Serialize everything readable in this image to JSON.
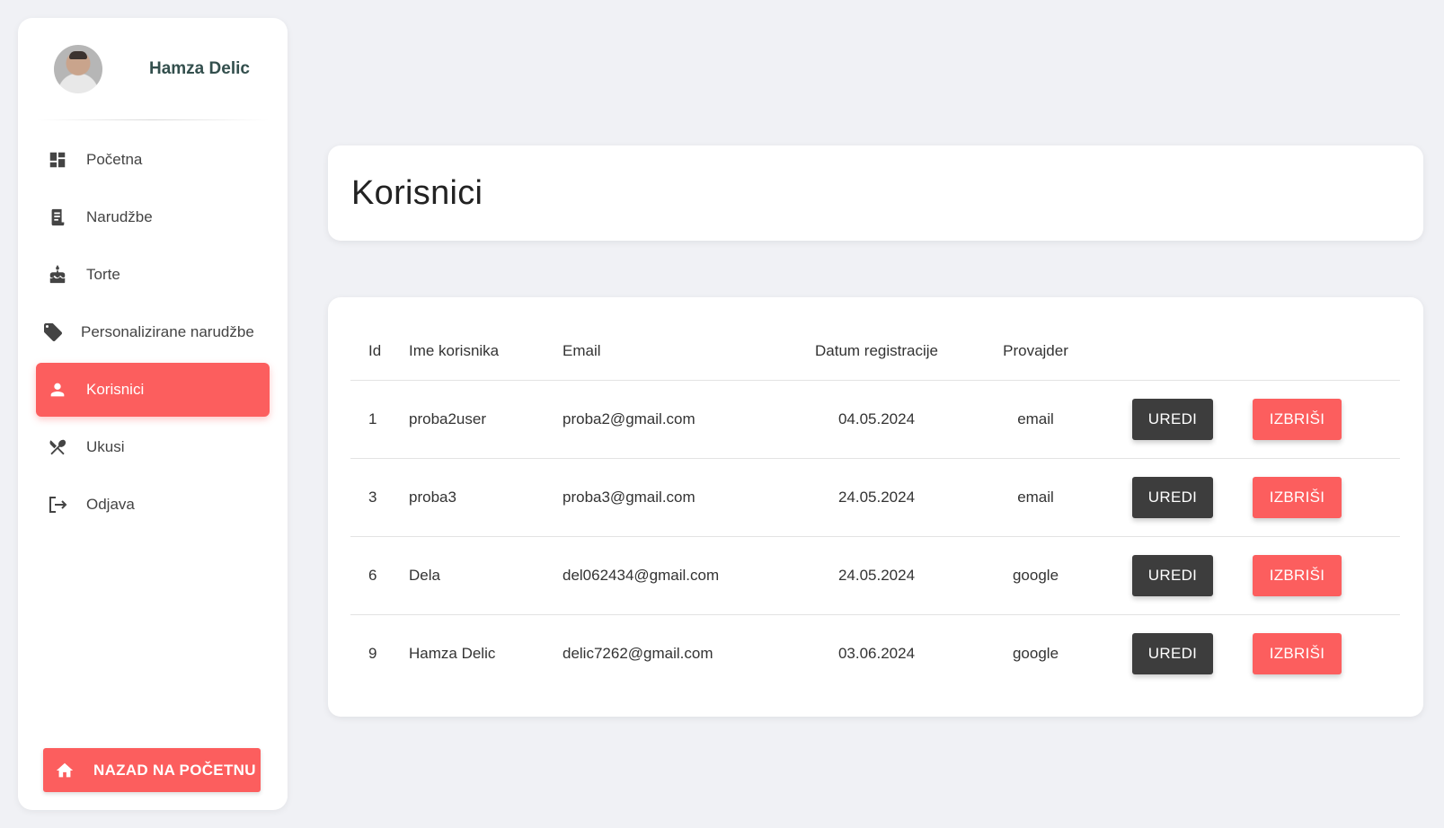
{
  "sidebar": {
    "user_name": "Hamza Delic",
    "items": [
      {
        "label": "Početna",
        "icon": "dashboard-icon"
      },
      {
        "label": "Narudžbe",
        "icon": "receipt-icon"
      },
      {
        "label": "Torte",
        "icon": "cake-icon"
      },
      {
        "label": "Personalizirane narudžbe",
        "icon": "tag-icon"
      },
      {
        "label": "Korisnici",
        "icon": "person-icon",
        "active": true
      },
      {
        "label": "Ukusi",
        "icon": "utensils-icon"
      },
      {
        "label": "Odjava",
        "icon": "logout-icon"
      }
    ],
    "home_button": "NAZAD NA POČETNU"
  },
  "header": {
    "title": "Korisnici"
  },
  "table": {
    "columns": [
      "Id",
      "Ime korisnika",
      "Email",
      "Datum registracije",
      "Provajder"
    ],
    "rows": [
      {
        "id": "1",
        "name": "proba2user",
        "email": "proba2@gmail.com",
        "date": "04.05.2024",
        "provider": "email"
      },
      {
        "id": "3",
        "name": "proba3",
        "email": "proba3@gmail.com",
        "date": "24.05.2024",
        "provider": "email"
      },
      {
        "id": "6",
        "name": "Dela",
        "email": "del062434@gmail.com",
        "date": "24.05.2024",
        "provider": "google"
      },
      {
        "id": "9",
        "name": "Hamza Delic",
        "email": "delic7262@gmail.com",
        "date": "03.06.2024",
        "provider": "google"
      }
    ],
    "edit_label": "UREDI",
    "delete_label": "IZBRIŠI"
  },
  "colors": {
    "accent": "#fc5e5e",
    "dark_button": "#3d3d3d",
    "background": "#f0f1f5"
  }
}
